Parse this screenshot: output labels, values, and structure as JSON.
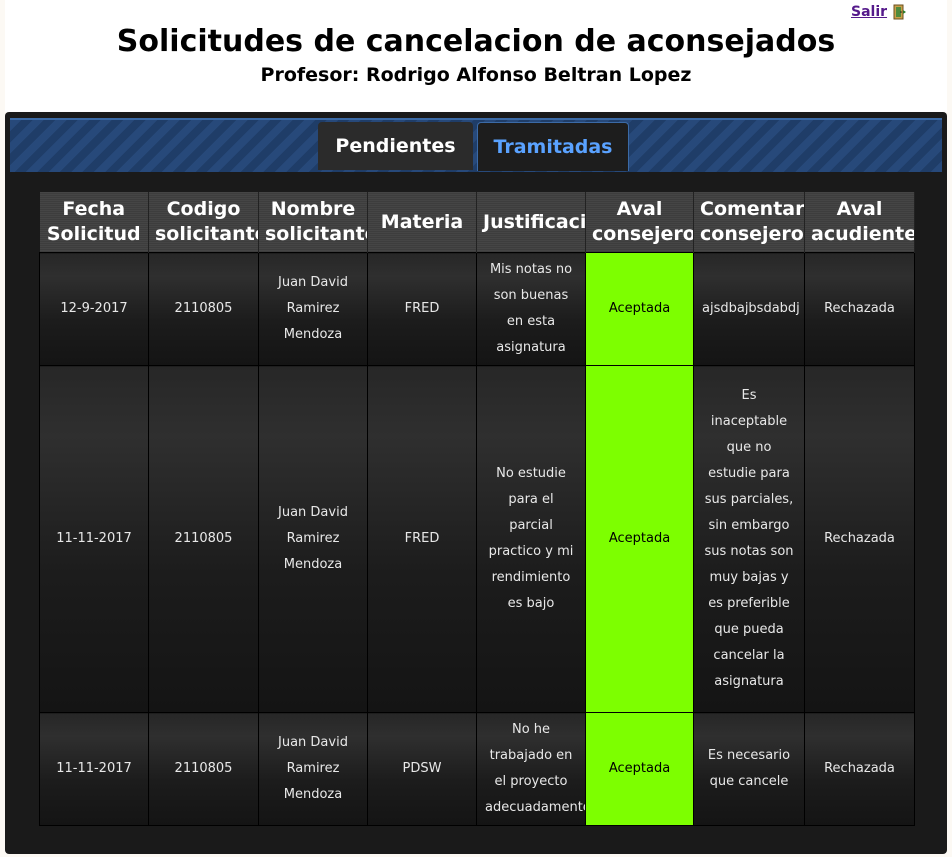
{
  "header": {
    "logout_label": "Salir",
    "title": "Solicitudes de cancelacion de aconsejados",
    "subtitle": "Profesor: Rodrigo Alfonso Beltran Lopez"
  },
  "tabs": [
    {
      "label": "Pendientes",
      "active": false
    },
    {
      "label": "Tramitadas",
      "active": true
    }
  ],
  "table": {
    "columns": [
      "Fecha Solicitud",
      "Codigo solicitante",
      "Nombre solicitante",
      "Materia",
      "Justificacion",
      "Aval consejero",
      "Comentario consejero",
      "Aval acudiente"
    ],
    "rows": [
      {
        "fecha": "12-9-2017",
        "codigo": "2110805",
        "nombre": "Juan David Ramirez Mendoza",
        "materia": "FRED",
        "justificacion": "Mis notas no son buenas en esta asignatura",
        "aval_consejero": "Aceptada",
        "comentario": "ajsdbajbsdabdj",
        "aval_acudiente": "Rechazada"
      },
      {
        "fecha": "11-11-2017",
        "codigo": "2110805",
        "nombre": "Juan David Ramirez Mendoza",
        "materia": "FRED",
        "justificacion": "No estudie para el parcial practico y mi rendimiento es bajo",
        "aval_consejero": "Aceptada",
        "comentario": "Es inaceptable que no estudie para sus parciales, sin embargo sus notas son muy bajas y es preferible que pueda cancelar la asignatura",
        "aval_acudiente": "Rechazada"
      },
      {
        "fecha": "11-11-2017",
        "codigo": "2110805",
        "nombre": "Juan David Ramirez Mendoza",
        "materia": "PDSW",
        "justificacion": "No he trabajado en el proyecto adecuadamente",
        "aval_consejero": "Aceptada",
        "comentario": "Es necesario que cancele",
        "aval_acudiente": "Rechazada"
      }
    ]
  },
  "colors": {
    "accept": "#7dff00",
    "tab_active": "#5aa2ff",
    "panel": "#1a1a1a"
  }
}
